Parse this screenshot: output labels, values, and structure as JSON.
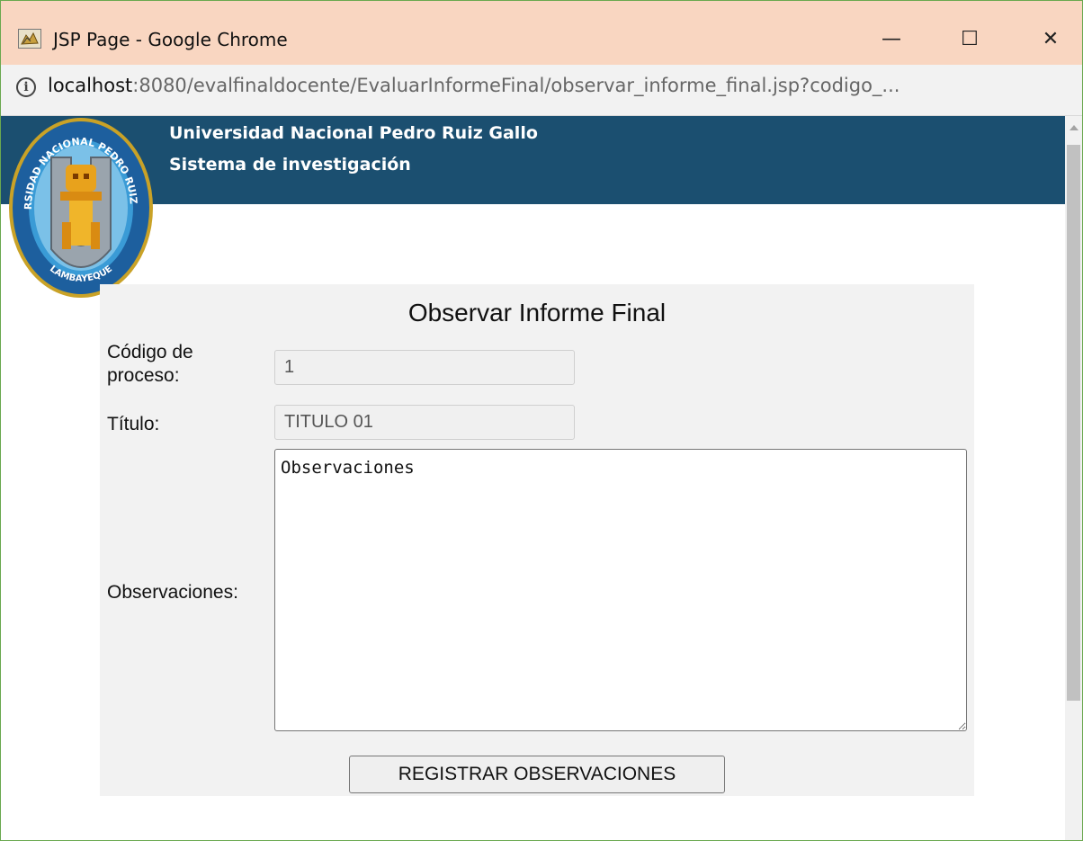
{
  "window": {
    "title": "JSP Page - Google Chrome",
    "minimize_symbol": "—",
    "maximize_symbol": "☐",
    "close_symbol": "✕"
  },
  "address_bar": {
    "info_symbol": "i",
    "host": "localhost",
    "rest": ":8080/evalfinaldocente/EvaluarInformeFinal/observar_informe_final.jsp?codigo_..."
  },
  "header": {
    "university_name": "Universidad Nacional Pedro Ruiz Gallo",
    "system_name": "Sistema de investigación",
    "logo_top_text": "UNIVERSIDAD NACIONAL PEDRO RUIZ GALLO",
    "logo_bottom_text": "LAMBAYEQUE"
  },
  "form": {
    "title": "Observar Informe Final",
    "code_label": "Código de proceso:",
    "code_value": "1",
    "title_label": "Título:",
    "title_value": "TITULO 01",
    "observations_label": "Observaciones:",
    "observations_value": "Observaciones",
    "submit_label": "REGISTRAR OBSERVACIONES"
  },
  "colors": {
    "titlebar": "#f9d6c1",
    "header": "#1b4f70",
    "window_border": "#6aa84f"
  }
}
